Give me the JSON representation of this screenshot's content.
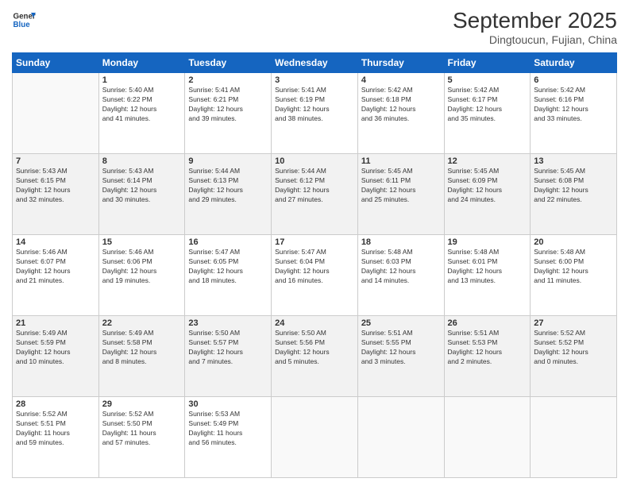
{
  "header": {
    "logo_line1": "General",
    "logo_line2": "Blue",
    "month": "September 2025",
    "location": "Dingtoucun, Fujian, China"
  },
  "days_of_week": [
    "Sunday",
    "Monday",
    "Tuesday",
    "Wednesday",
    "Thursday",
    "Friday",
    "Saturday"
  ],
  "weeks": [
    [
      {
        "day": "",
        "info": ""
      },
      {
        "day": "1",
        "info": "Sunrise: 5:40 AM\nSunset: 6:22 PM\nDaylight: 12 hours\nand 41 minutes."
      },
      {
        "day": "2",
        "info": "Sunrise: 5:41 AM\nSunset: 6:21 PM\nDaylight: 12 hours\nand 39 minutes."
      },
      {
        "day": "3",
        "info": "Sunrise: 5:41 AM\nSunset: 6:19 PM\nDaylight: 12 hours\nand 38 minutes."
      },
      {
        "day": "4",
        "info": "Sunrise: 5:42 AM\nSunset: 6:18 PM\nDaylight: 12 hours\nand 36 minutes."
      },
      {
        "day": "5",
        "info": "Sunrise: 5:42 AM\nSunset: 6:17 PM\nDaylight: 12 hours\nand 35 minutes."
      },
      {
        "day": "6",
        "info": "Sunrise: 5:42 AM\nSunset: 6:16 PM\nDaylight: 12 hours\nand 33 minutes."
      }
    ],
    [
      {
        "day": "7",
        "info": "Sunrise: 5:43 AM\nSunset: 6:15 PM\nDaylight: 12 hours\nand 32 minutes."
      },
      {
        "day": "8",
        "info": "Sunrise: 5:43 AM\nSunset: 6:14 PM\nDaylight: 12 hours\nand 30 minutes."
      },
      {
        "day": "9",
        "info": "Sunrise: 5:44 AM\nSunset: 6:13 PM\nDaylight: 12 hours\nand 29 minutes."
      },
      {
        "day": "10",
        "info": "Sunrise: 5:44 AM\nSunset: 6:12 PM\nDaylight: 12 hours\nand 27 minutes."
      },
      {
        "day": "11",
        "info": "Sunrise: 5:45 AM\nSunset: 6:11 PM\nDaylight: 12 hours\nand 25 minutes."
      },
      {
        "day": "12",
        "info": "Sunrise: 5:45 AM\nSunset: 6:09 PM\nDaylight: 12 hours\nand 24 minutes."
      },
      {
        "day": "13",
        "info": "Sunrise: 5:45 AM\nSunset: 6:08 PM\nDaylight: 12 hours\nand 22 minutes."
      }
    ],
    [
      {
        "day": "14",
        "info": "Sunrise: 5:46 AM\nSunset: 6:07 PM\nDaylight: 12 hours\nand 21 minutes."
      },
      {
        "day": "15",
        "info": "Sunrise: 5:46 AM\nSunset: 6:06 PM\nDaylight: 12 hours\nand 19 minutes."
      },
      {
        "day": "16",
        "info": "Sunrise: 5:47 AM\nSunset: 6:05 PM\nDaylight: 12 hours\nand 18 minutes."
      },
      {
        "day": "17",
        "info": "Sunrise: 5:47 AM\nSunset: 6:04 PM\nDaylight: 12 hours\nand 16 minutes."
      },
      {
        "day": "18",
        "info": "Sunrise: 5:48 AM\nSunset: 6:03 PM\nDaylight: 12 hours\nand 14 minutes."
      },
      {
        "day": "19",
        "info": "Sunrise: 5:48 AM\nSunset: 6:01 PM\nDaylight: 12 hours\nand 13 minutes."
      },
      {
        "day": "20",
        "info": "Sunrise: 5:48 AM\nSunset: 6:00 PM\nDaylight: 12 hours\nand 11 minutes."
      }
    ],
    [
      {
        "day": "21",
        "info": "Sunrise: 5:49 AM\nSunset: 5:59 PM\nDaylight: 12 hours\nand 10 minutes."
      },
      {
        "day": "22",
        "info": "Sunrise: 5:49 AM\nSunset: 5:58 PM\nDaylight: 12 hours\nand 8 minutes."
      },
      {
        "day": "23",
        "info": "Sunrise: 5:50 AM\nSunset: 5:57 PM\nDaylight: 12 hours\nand 7 minutes."
      },
      {
        "day": "24",
        "info": "Sunrise: 5:50 AM\nSunset: 5:56 PM\nDaylight: 12 hours\nand 5 minutes."
      },
      {
        "day": "25",
        "info": "Sunrise: 5:51 AM\nSunset: 5:55 PM\nDaylight: 12 hours\nand 3 minutes."
      },
      {
        "day": "26",
        "info": "Sunrise: 5:51 AM\nSunset: 5:53 PM\nDaylight: 12 hours\nand 2 minutes."
      },
      {
        "day": "27",
        "info": "Sunrise: 5:52 AM\nSunset: 5:52 PM\nDaylight: 12 hours\nand 0 minutes."
      }
    ],
    [
      {
        "day": "28",
        "info": "Sunrise: 5:52 AM\nSunset: 5:51 PM\nDaylight: 11 hours\nand 59 minutes."
      },
      {
        "day": "29",
        "info": "Sunrise: 5:52 AM\nSunset: 5:50 PM\nDaylight: 11 hours\nand 57 minutes."
      },
      {
        "day": "30",
        "info": "Sunrise: 5:53 AM\nSunset: 5:49 PM\nDaylight: 11 hours\nand 56 minutes."
      },
      {
        "day": "",
        "info": ""
      },
      {
        "day": "",
        "info": ""
      },
      {
        "day": "",
        "info": ""
      },
      {
        "day": "",
        "info": ""
      }
    ]
  ]
}
